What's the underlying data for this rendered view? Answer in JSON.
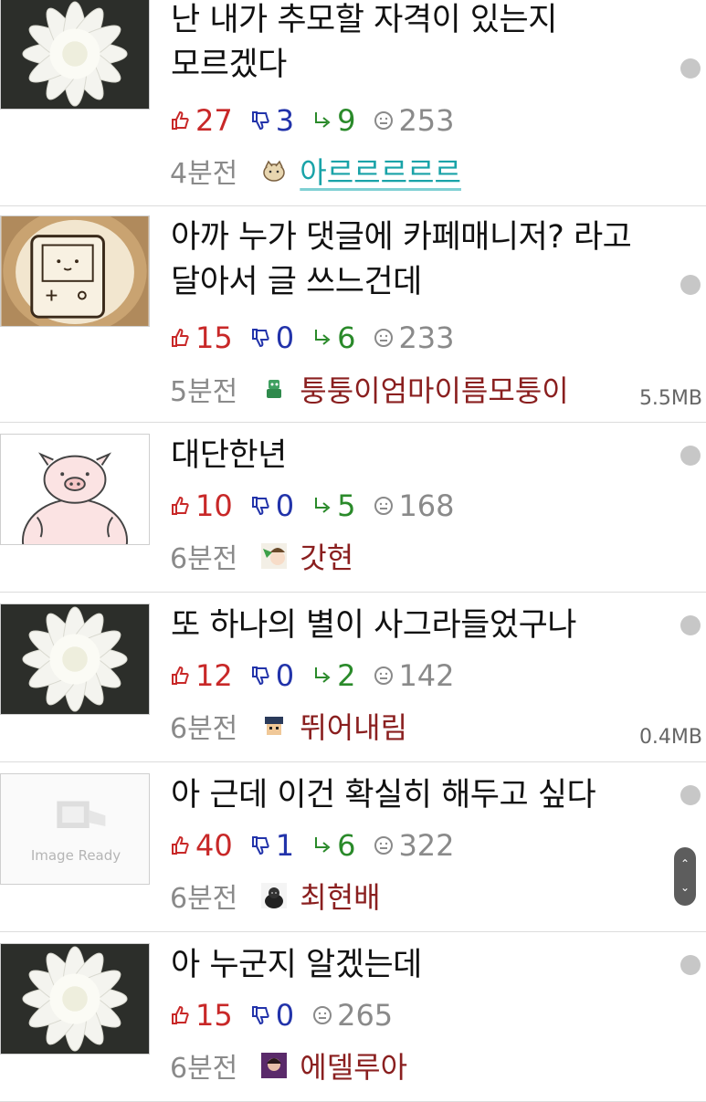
{
  "posts": [
    {
      "title": "난 내가 추모할 자격이 있는지 모르겠다",
      "upvotes": "27",
      "downvotes": "3",
      "replies": "9",
      "views": "253",
      "time": "4분전",
      "author": "아르르르르르",
      "file_size": "",
      "thumbnail": "white-chrysanthemum",
      "avatar": "cat-avatar",
      "name_color": "#19a3a8"
    },
    {
      "title": "아까 누가 댓글에 카페매니저? 라고 달아서 글 쓰느건데",
      "upvotes": "15",
      "downvotes": "0",
      "replies": "6",
      "views": "233",
      "time": "5분전",
      "author": "퉁퉁이엄마이름모퉁이",
      "file_size": "5.5MB",
      "thumbnail": "latte-art-bmo",
      "avatar": "green-robot-avatar",
      "name_color": "#8a1f1f"
    },
    {
      "title": "대단한년",
      "upvotes": "10",
      "downvotes": "0",
      "replies": "5",
      "views": "168",
      "time": "6분전",
      "author": "갓현",
      "file_size": "",
      "thumbnail": "pig-drawing",
      "avatar": "anime-avatar",
      "name_color": "#8a1f1f"
    },
    {
      "title": "또 하나의 별이 사그라들었구나",
      "upvotes": "12",
      "downvotes": "0",
      "replies": "2",
      "views": "142",
      "time": "6분전",
      "author": "뛰어내림",
      "file_size": "0.4MB",
      "thumbnail": "white-chrysanthemum",
      "avatar": "pixel-man-avatar",
      "name_color": "#8a1f1f"
    },
    {
      "title": "아 근데 이건 확실히 해두고 싶다",
      "upvotes": "40",
      "downvotes": "1",
      "replies": "6",
      "views": "322",
      "time": "6분전",
      "author": "최현배",
      "file_size": "",
      "thumbnail": "image-ready-placeholder",
      "thumbnail_text": "Image Ready",
      "avatar": "gorilla-avatar",
      "name_color": "#8a1f1f"
    },
    {
      "title": "아 누군지 알겠는데",
      "upvotes": "15",
      "downvotes": "0",
      "replies": "",
      "views": "265",
      "time": "6분전",
      "author": "에델루아",
      "file_size": "",
      "thumbnail": "white-chrysanthemum",
      "avatar": "portrait-avatar",
      "name_color": "#8a1f1f"
    }
  ],
  "colors": {
    "upvote": "#c82828",
    "downvote": "#2233aa",
    "reply": "#2a8a2a",
    "view": "#8a8a8a",
    "divider": "#dcdcdc",
    "unread_dot": "#c7c7c7"
  },
  "icons": {
    "upvote": "thumbs-up-icon",
    "downvote": "thumbs-down-icon",
    "reply": "reply-arrow-icon",
    "view": "view-count-icon"
  }
}
